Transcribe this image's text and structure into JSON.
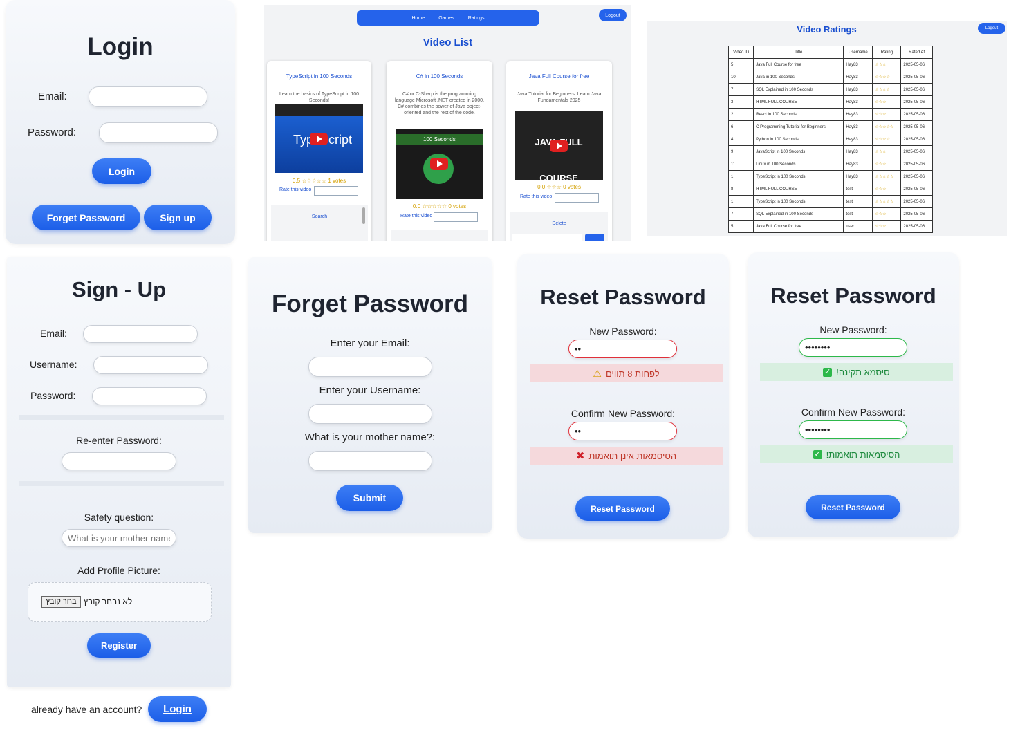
{
  "login": {
    "title": "Login",
    "email_label": "Email:",
    "password_label": "Password:",
    "login_button": "Login",
    "forget_button": "Forget Password",
    "signup_button": "Sign up"
  },
  "video_list": {
    "nav": [
      "Home",
      "Games",
      "Ratings"
    ],
    "logout": "Logout",
    "title": "Video List",
    "cards": [
      {
        "title": "TypeScript in 100 Seconds",
        "desc": "Learn the basics of TypeScript in 100 Seconds!",
        "rating": "0.5 ☆☆☆☆☆ 1 votes",
        "rate_label": "Rate this video"
      },
      {
        "title": "C# in 100 Seconds",
        "desc": "C# or C-Sharp is the programming language Microsoft .NET created in 2000. C# combines the power of Java object-oriented and the rest of the code.",
        "rating": "0.0 ☆☆☆☆☆ 0 votes",
        "rate_label": "Rate this video"
      },
      {
        "title": "Java Full Course for free",
        "desc": "Java Tutorial for Beginners: Learn Java Fundamentals 2025",
        "rating": "0.0 ☆☆☆ 0 votes",
        "rate_label": "Rate this video"
      }
    ],
    "thumb_texts": [
      "TypeScript",
      "100 Seconds",
      "JAVA FULL COURSE"
    ],
    "extra_labels": [
      "Search",
      "Delete"
    ]
  },
  "video_ratings": {
    "title": "Video Ratings",
    "logout": "Logout",
    "columns": [
      "Video ID",
      "Title",
      "Username",
      "Rating",
      "Rated At"
    ],
    "rows": [
      [
        "5",
        "Java Full Course for free",
        "Hay83",
        "☆☆☆",
        "2025-05-06"
      ],
      [
        "10",
        "Java in 100 Seconds",
        "Hay83",
        "☆☆☆☆",
        "2025-05-06"
      ],
      [
        "7",
        "SQL Explained in 100 Seconds",
        "Hay83",
        "☆☆☆☆",
        "2025-05-06"
      ],
      [
        "3",
        "HTML FULL COURSE",
        "Hay83",
        "☆☆☆",
        "2025-05-06"
      ],
      [
        "2",
        "React in 100 Seconds",
        "Hay83",
        "☆☆☆",
        "2025-05-06"
      ],
      [
        "6",
        "C Programming Tutorial for Beginners",
        "Hay83",
        "☆☆☆☆☆",
        "2025-05-06"
      ],
      [
        "4",
        "Python in 100 Seconds",
        "Hay83",
        "☆☆☆☆",
        "2025-05-06"
      ],
      [
        "9",
        "JavaScript in 100 Seconds",
        "Hay83",
        "☆☆☆",
        "2025-05-06"
      ],
      [
        "11",
        "Linux in 100 Seconds",
        "Hay83",
        "☆☆☆",
        "2025-05-06"
      ],
      [
        "1",
        "TypeScript in 100 Seconds",
        "Hay83",
        "☆☆☆☆☆",
        "2025-05-06"
      ],
      [
        "8",
        "HTML FULL COURSE",
        "test",
        "☆☆☆",
        "2025-05-06"
      ],
      [
        "1",
        "TypeScript in 100 Seconds",
        "test",
        "☆☆☆☆☆",
        "2025-05-06"
      ],
      [
        "7",
        "SQL Explained in 100 Seconds",
        "test",
        "☆☆☆",
        "2025-05-06"
      ],
      [
        "5",
        "Java Full Course for free",
        "user",
        "☆☆☆",
        "2025-05-06"
      ]
    ]
  },
  "signup": {
    "title": "Sign - Up",
    "email_label": "Email:",
    "username_label": "Username:",
    "password_label": "Password:",
    "reenter_label": "Re-enter Password:",
    "safety_label": "Safety question:",
    "safety_placeholder": "What is your mother name?",
    "picture_label": "Add Profile Picture:",
    "choose_file": "בחר קובץ",
    "no_file": "לא נבחר קובץ",
    "register_button": "Register",
    "have_account": "already have an account?",
    "login_button": "Login"
  },
  "forget": {
    "title": "Forget Password",
    "email_label": "Enter your Email:",
    "username_label": "Enter your Username:",
    "mother_label": "What is your mother name?:",
    "submit_button": "Submit"
  },
  "reset_invalid": {
    "title": "Reset Password",
    "new_label": "New Password:",
    "new_value": "••",
    "new_msg": "לפחות 8 תווים",
    "confirm_label": "Confirm New Password:",
    "confirm_value": "••",
    "confirm_msg": "הסיסמאות אינן תואמות",
    "button": "Reset Password"
  },
  "reset_valid": {
    "title": "Reset Password",
    "new_label": "New Password:",
    "new_value": "••••••••",
    "new_msg": "סיסמא תקינה!",
    "confirm_label": "Confirm New Password:",
    "confirm_value": "••••••••",
    "confirm_msg": "הסיסמאות תואמות!",
    "button": "Reset Password"
  },
  "colors": {
    "accent": "#2563eb",
    "error_bg": "#f5d9dc",
    "error_text": "#c0392b",
    "success_bg": "#d8efe0",
    "success_text": "#1e8a3e"
  }
}
